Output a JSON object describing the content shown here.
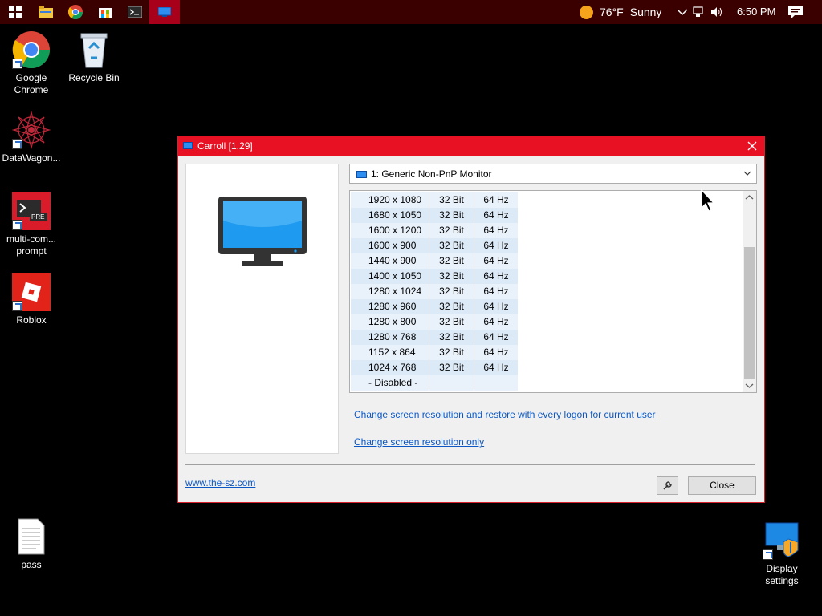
{
  "taskbar": {
    "weather": {
      "temp": "76°F",
      "condition": "Sunny"
    },
    "clock": "6:50 PM"
  },
  "desktop": {
    "icons": [
      {
        "label": "Google Chrome"
      },
      {
        "label": "Recycle Bin"
      },
      {
        "label": "DataWagon..."
      },
      {
        "label": "multi-com... prompt"
      },
      {
        "label": "Roblox"
      },
      {
        "label": "pass"
      },
      {
        "label": "Display settings"
      }
    ]
  },
  "dialog": {
    "title": "Carroll [1.29]",
    "monitor_select": "1: Generic Non-PnP Monitor",
    "resolutions": [
      {
        "res": "1920 x 1080",
        "bits": "32 Bit",
        "hz": "64 Hz"
      },
      {
        "res": "1680 x 1050",
        "bits": "32 Bit",
        "hz": "64 Hz"
      },
      {
        "res": "1600 x 1200",
        "bits": "32 Bit",
        "hz": "64 Hz"
      },
      {
        "res": "1600 x 900",
        "bits": "32 Bit",
        "hz": "64 Hz"
      },
      {
        "res": "1440 x 900",
        "bits": "32 Bit",
        "hz": "64 Hz"
      },
      {
        "res": "1400 x 1050",
        "bits": "32 Bit",
        "hz": "64 Hz"
      },
      {
        "res": "1280 x 1024",
        "bits": "32 Bit",
        "hz": "64 Hz"
      },
      {
        "res": "1280 x 960",
        "bits": "32 Bit",
        "hz": "64 Hz"
      },
      {
        "res": "1280 x 800",
        "bits": "32 Bit",
        "hz": "64 Hz"
      },
      {
        "res": "1280 x 768",
        "bits": "32 Bit",
        "hz": "64 Hz"
      },
      {
        "res": "1152 x 864",
        "bits": "32 Bit",
        "hz": "64 Hz"
      },
      {
        "res": "1024 x 768",
        "bits": "32 Bit",
        "hz": "64 Hz"
      },
      {
        "res": "- Disabled -",
        "bits": "",
        "hz": ""
      }
    ],
    "link_restore": "Change screen resolution and restore with every logon for current user",
    "link_only": "Change screen resolution only",
    "site_link": "www.the-sz.com",
    "close_button": "Close"
  },
  "colors": {
    "titlebar": "#e81123",
    "taskbar": "#3a0000",
    "link": "#0b58c5"
  }
}
